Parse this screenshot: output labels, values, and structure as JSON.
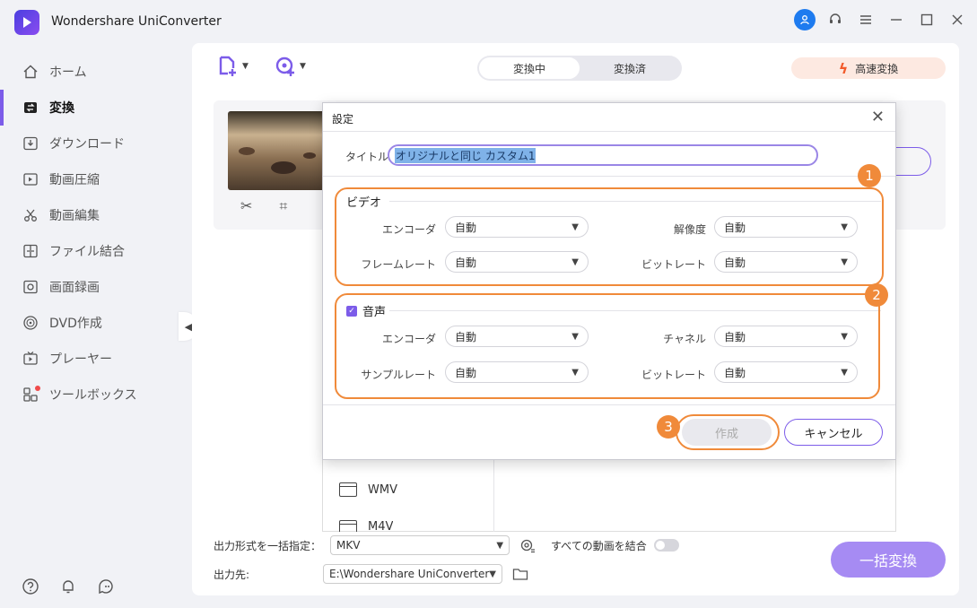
{
  "app": {
    "title": "Wondershare UniConverter"
  },
  "sidebar": {
    "items": [
      {
        "label": "ホーム",
        "icon": "home-icon"
      },
      {
        "label": "変換",
        "icon": "convert-icon",
        "active": true
      },
      {
        "label": "ダウンロード",
        "icon": "download-icon"
      },
      {
        "label": "動画圧縮",
        "icon": "compress-icon"
      },
      {
        "label": "動画編集",
        "icon": "scissors-icon"
      },
      {
        "label": "ファイル結合",
        "icon": "merge-icon"
      },
      {
        "label": "画面録画",
        "icon": "record-icon"
      },
      {
        "label": "DVD作成",
        "icon": "dvd-icon"
      },
      {
        "label": "プレーヤー",
        "icon": "player-icon"
      },
      {
        "label": "ツールボックス",
        "icon": "toolbox-icon"
      }
    ]
  },
  "toolbar": {
    "tabs": [
      "変換中",
      "変換済"
    ],
    "high_speed": "高速変換"
  },
  "bottom": {
    "format_label": "出力形式を一括指定：",
    "format_value": "MKV",
    "merge_label": "すべての動画を結合",
    "output_label": "出力先:",
    "output_path": "E:\\Wondershare UniConverter",
    "convert_all": "一括変換"
  },
  "format_list": [
    "WMV",
    "M4V"
  ],
  "dialog": {
    "title": "設定",
    "title_label": "タイトル",
    "title_value": "オリジナルと同じ カスタム1",
    "video": {
      "heading": "ビデオ",
      "encoder_label": "エンコーダ",
      "encoder_value": "自動",
      "resolution_label": "解像度",
      "resolution_value": "自動",
      "framerate_label": "フレームレート",
      "framerate_value": "自動",
      "bitrate_label": "ビットレート",
      "bitrate_value": "自動"
    },
    "audio": {
      "heading": "音声",
      "encoder_label": "エンコーダ",
      "encoder_value": "自動",
      "channel_label": "チャネル",
      "channel_value": "自動",
      "samplerate_label": "サンプルレート",
      "samplerate_value": "自動",
      "bitrate_label": "ビットレート",
      "bitrate_value": "自動"
    },
    "create": "作成",
    "cancel": "キャンセル"
  },
  "annotations": [
    "1",
    "2",
    "3"
  ],
  "colors": {
    "accent": "#7c5ce9",
    "highlight": "#f08a3a",
    "user": "#1e7bef"
  }
}
